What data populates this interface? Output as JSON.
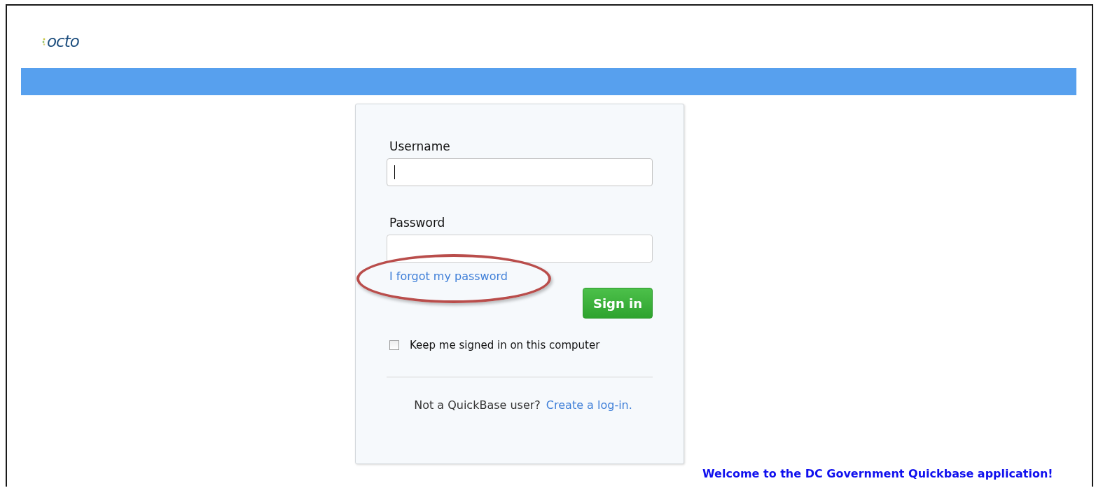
{
  "logo": {
    "text": "octo"
  },
  "login": {
    "username": {
      "label": "Username",
      "focused": true
    },
    "password": {
      "label": "Password",
      "focused": false
    },
    "forgot_link": {
      "label": "I forgot my password",
      "highlighted": true
    },
    "sign_in_button": "Sign in",
    "keep_signed_in": {
      "label": "Keep me signed in on this computer",
      "checked": false
    },
    "footer": {
      "prompt": "Not a QuickBase user?",
      "link": "Create a log-in."
    }
  },
  "welcome": "Welcome to the DC Government Quickbase application!"
}
